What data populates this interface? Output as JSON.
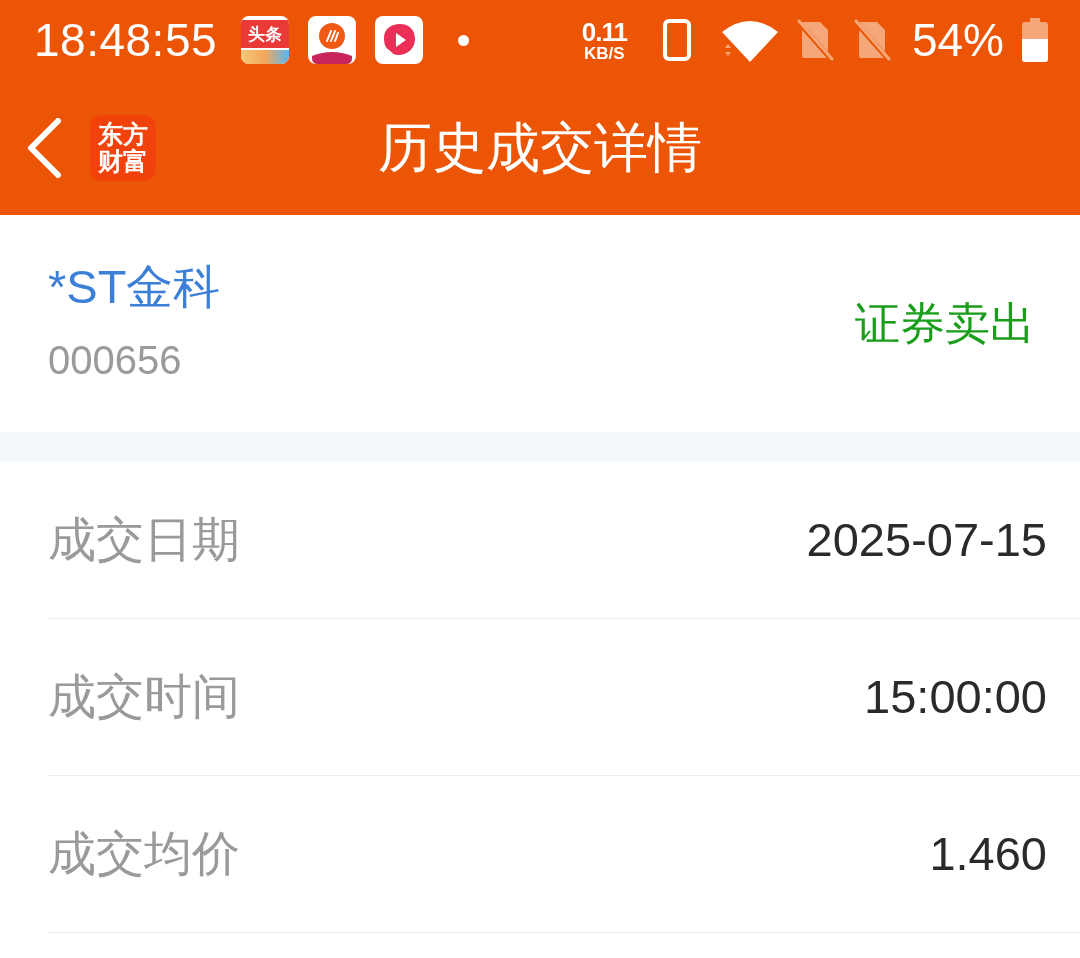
{
  "status_bar": {
    "time": "18:48:55",
    "notifications": [
      {
        "kind": "news",
        "label": "头条"
      },
      {
        "kind": "music"
      },
      {
        "kind": "video"
      }
    ],
    "net_speed": {
      "value": "0.11",
      "unit": "KB/S"
    },
    "battery": "54%"
  },
  "header": {
    "logo": "东方财富",
    "title": "历史成交详情"
  },
  "stock": {
    "name": "*ST金科",
    "code": "000656",
    "direction": "证券卖出"
  },
  "details": [
    {
      "label": "成交日期",
      "value": "2025-07-15"
    },
    {
      "label": "成交时间",
      "value": "15:00:00"
    },
    {
      "label": "成交均价",
      "value": "1.460"
    }
  ]
}
